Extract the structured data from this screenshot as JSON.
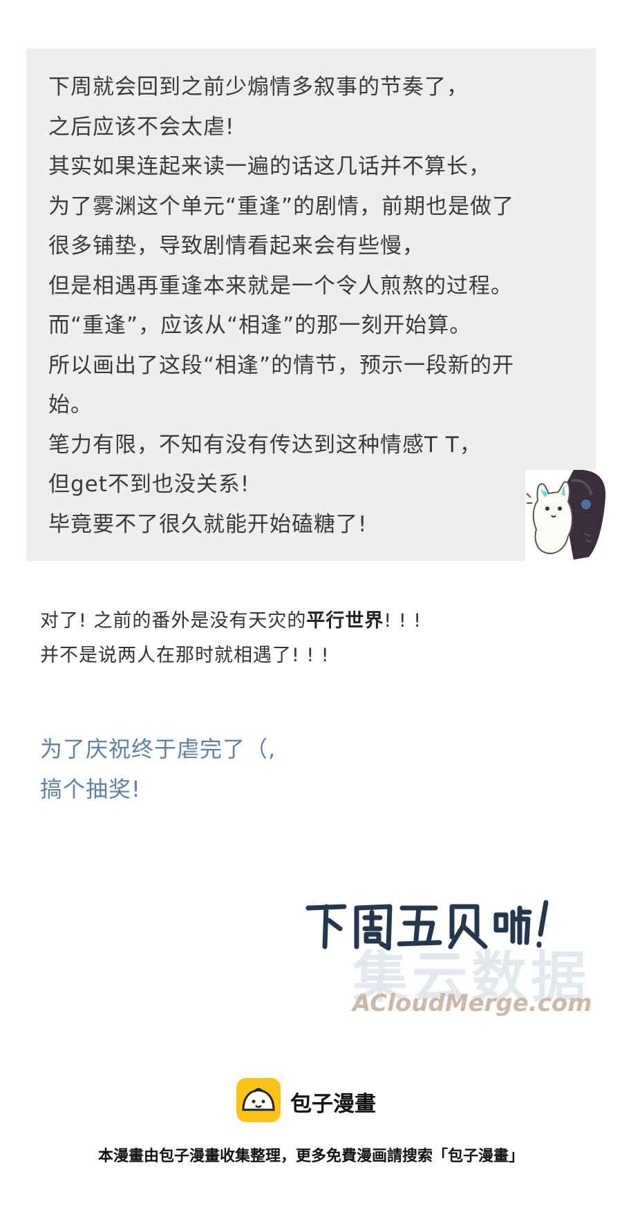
{
  "note_box": {
    "lines": [
      "下周就会回到之前少煽情多叙事的节奏了，",
      "之后应该不会太虐!",
      "其实如果连起来读一遍的话这几话并不算长，",
      "为了雾渊这个单元“重逢”的剧情，前期也是做了",
      "很多铺垫，导致剧情看起来会有些慢，",
      "但是相遇再重逢本来就是一个令人煎熬的过程。",
      "而“重逢”，应该从“相逢”的那一刻开始算。",
      "所以画出了这段“相逢”的情节，预示一段新的开",
      "始。",
      "笔力有限，不知有没有传达到这种情感T T，",
      "但get不到也没关系!",
      "毕竟要不了很久就能开始磕糖了!"
    ]
  },
  "sticker": {
    "icon": "cat-sticker-icon",
    "mark": "ᵃ"
  },
  "notice": {
    "line1_before": "对了!  之前的番外是没有天灾的",
    "line1_bold": "平行世界",
    "line1_after": "!  !  !",
    "line2": "并不是说两人在那时就相遇了!  !  !"
  },
  "lottery": {
    "line1": "为了庆祝终于虐完了（,",
    "line2": "搞个抽奖!"
  },
  "handwritten": {
    "text": "下周五见啦!"
  },
  "watermark": {
    "cn": "集云数据",
    "en": "ACloudMerge.com"
  },
  "footer": {
    "brand": "包子漫畫",
    "note": "本漫畫由包子漫畫收集整理，更多免費漫画請搜索「包子漫畫」"
  },
  "colors": {
    "box_bg": "#eeeeee",
    "blue_text": "#5b82a6",
    "handwriting": "#23384f",
    "logo_yellow": "#f9c413"
  }
}
